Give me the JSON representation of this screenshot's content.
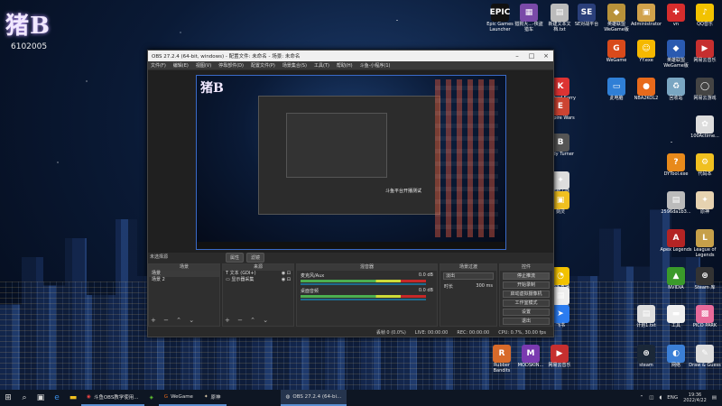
{
  "brand": {
    "logo_text": "猪B",
    "number": "6102005"
  },
  "desktop_icons_top": [
    {
      "label": "Epic Games Launcher",
      "glyph": "EPIC",
      "color": "#111"
    },
    {
      "label": "猎狗大...-侠盗猎车",
      "glyph": "▦",
      "color": "#7a4aa8"
    },
    {
      "label": "新建文本文档.txt",
      "glyph": "▤",
      "color": "#bbb"
    },
    {
      "label": "SE对战平台",
      "glyph": "SE",
      "color": "#2a3f7a"
    },
    {
      "label": "英雄联盟WeGame版",
      "glyph": "◆",
      "color": "#b8923a"
    },
    {
      "label": "Administrator",
      "glyph": "▣",
      "color": "#d1a24b"
    },
    {
      "label": "vn",
      "glyph": "✚",
      "color": "#d62d2d"
    },
    {
      "label": "QQ音乐",
      "glyph": "♪",
      "color": "#f2c200"
    }
  ],
  "desktop_icons_right": [
    {
      "label": "WeGame",
      "glyph": "G",
      "color": "#d84a1b"
    },
    {
      "label": "YY.exe",
      "glyph": "☺",
      "color": "#f5b800"
    },
    {
      "label": "英雄联盟WeGame版",
      "glyph": "◆",
      "color": "#2a5ab0"
    },
    {
      "label": "网易云音乐",
      "glyph": "▶",
      "color": "#c62f2f"
    },
    {
      "label": "此电脑",
      "glyph": "▭",
      "color": "#2f7fd6"
    },
    {
      "label": "NBA2KOL2",
      "glyph": "●",
      "color": "#e86a1b"
    },
    {
      "label": "回收站",
      "glyph": "♻",
      "color": "#7aa6c2"
    },
    {
      "label": "网易云游戏",
      "glyph": "◯",
      "color": "#444"
    },
    {
      "label": "100Actime...",
      "glyph": "✿",
      "color": "#ddd"
    },
    {
      "label": "DYTool.exe",
      "glyph": "?",
      "color": "#e88a1b"
    },
    {
      "label": "代码本",
      "glyph": "⚙",
      "color": "#f0c020"
    },
    {
      "label": "2596da1b3...",
      "glyph": "▤",
      "color": "#bbb"
    },
    {
      "label": "原神",
      "glyph": "✦",
      "color": "#e6d2b0"
    },
    {
      "label": "Apex Legends",
      "glyph": "A",
      "color": "#b32424"
    },
    {
      "label": "League of Legends",
      "glyph": "L",
      "color": "#c6a04a"
    },
    {
      "label": "NVIDIA",
      "glyph": "▲",
      "color": "#3a9a2a"
    },
    {
      "label": "Steam 库",
      "glyph": "⊛",
      "color": "#333"
    },
    {
      "label": "计划1.txt",
      "glyph": "▤",
      "color": "#ddd"
    },
    {
      "label": "工具",
      "glyph": "▬",
      "color": "#eee"
    },
    {
      "label": "PICO PARK",
      "glyph": "▩",
      "color": "#e86a9a"
    },
    {
      "label": "steam",
      "glyph": "⊛",
      "color": "#1b2838"
    },
    {
      "label": "网络",
      "glyph": "◐",
      "color": "#3b7fd6"
    },
    {
      "label": "Draw & Guess",
      "glyph": "✎",
      "color": "#ddd"
    }
  ],
  "desktop_icons_mid": [
    {
      "label": "Kindred Sorry",
      "glyph": "K",
      "color": "#d33"
    },
    {
      "label": "empire Wars",
      "glyph": "E",
      "color": "#c43"
    },
    {
      "label": "Body Turner",
      "glyph": "B",
      "color": "#555"
    },
    {
      "label": "穿越火线",
      "glyph": "✦",
      "color": "#ddd"
    },
    {
      "label": "剑灵",
      "glyph": "▣",
      "color": "#f0c020"
    },
    {
      "label": "快手直播",
      "glyph": "◔",
      "color": "#f2c200"
    },
    {
      "label": "腾讯文件",
      "glyph": "▤",
      "color": "#eee"
    },
    {
      "label": "飞书",
      "glyph": "➤",
      "color": "#2b7cf0"
    }
  ],
  "desktop_icons_bottom": [
    {
      "label": "Rubber Bandits",
      "glyph": "R",
      "color": "#d86a2a"
    },
    {
      "label": "MODSKIN...",
      "glyph": "M",
      "color": "#7a3ab0"
    },
    {
      "label": "网易云音乐",
      "glyph": "▶",
      "color": "#c62f2f"
    }
  ],
  "obs": {
    "title": "OBS 27.2.4 (64-bit, windows) - 配置文件: 未命名 - 场景: 未命名",
    "menu": [
      "文件(F)",
      "编辑(E)",
      "视图(V)",
      "停靠部件(D)",
      "配置文件(P)",
      "场景集合(S)",
      "工具(T)",
      "帮助(H)",
      "斗鱼-小程序(1)"
    ],
    "inner_caption": "斗鱼平台开播测试",
    "scene_hint": "未选择源",
    "mini_buttons": [
      "属性",
      "滤镜"
    ],
    "scenes_header": "场景",
    "scenes": [
      "场景",
      "场景 2"
    ],
    "sources_header": "来源",
    "sources": [
      {
        "name": "文本 (GDI+)",
        "glyph": "T"
      },
      {
        "name": "显示器采集",
        "glyph": "▭"
      }
    ],
    "mixer_header": "混音器",
    "mixer": [
      {
        "name": "麦克风/Aux",
        "db": "0.0 dB"
      },
      {
        "name": "桌面音频",
        "db": "0.0 dB"
      }
    ],
    "transitions_header": "场景过渡",
    "transition_type": "淡出",
    "duration_label": "时长",
    "duration_value": "300 ms",
    "controls_header": "控件",
    "controls": [
      "停止推流",
      "开始录制",
      "启动虚拟摄像机",
      "工作室模式",
      "设置",
      "退出"
    ],
    "status": [
      "丢帧 0 (0.0%)",
      "LIVE: 00:00:00",
      "REC: 00:00:00",
      "CPU: 0.7%, 30.00 fps"
    ],
    "footer_ctrl": "+ − ⌃ ⌄"
  },
  "taskbar": {
    "apps": [
      {
        "label": "斗鱼OBS教学使用...",
        "glyph": "◉"
      },
      {
        "label": "",
        "glyph": "◈"
      },
      {
        "label": "WeGame",
        "glyph": "G"
      },
      {
        "label": "原神",
        "glyph": "✦"
      },
      {
        "label": "OBS 27.2.4 (64-bi...",
        "glyph": "◍"
      }
    ],
    "lang": "ENG",
    "time": "19:36",
    "date": "2022/4/22"
  }
}
